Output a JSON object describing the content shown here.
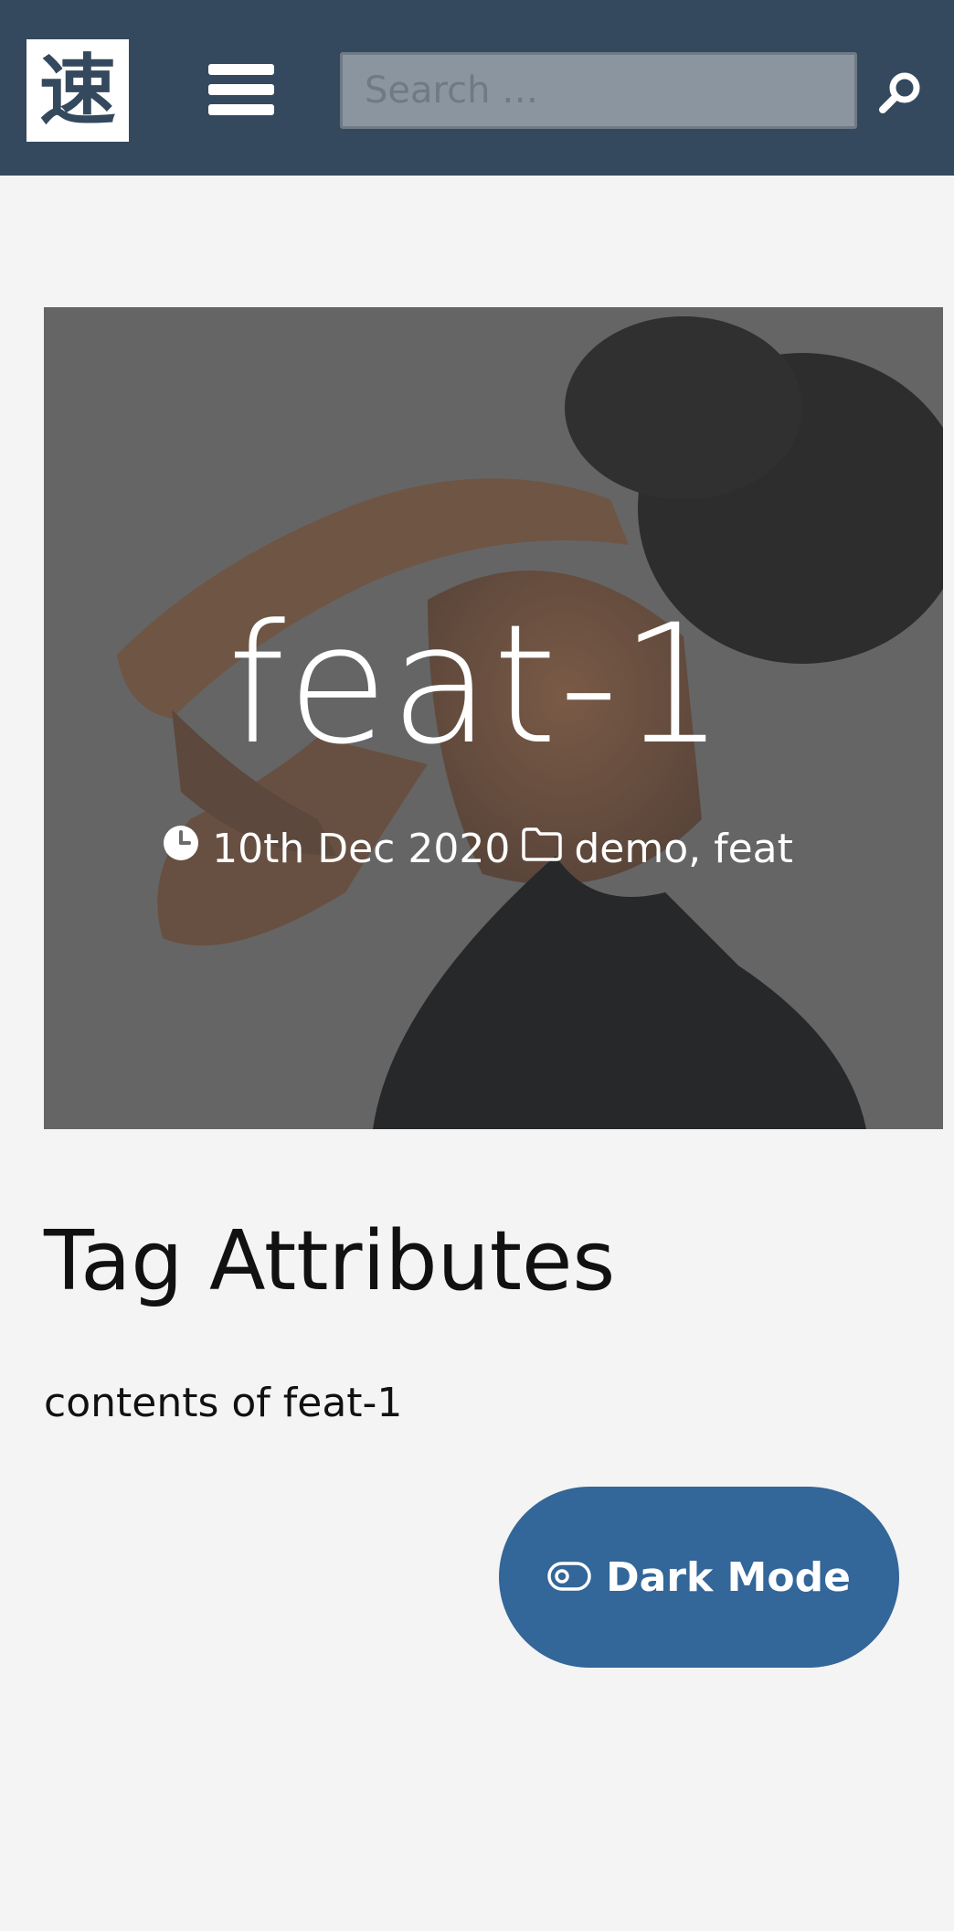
{
  "header": {
    "logo_text": "速",
    "menu_icon": "hamburger-menu-icon",
    "search": {
      "placeholder": "Search …",
      "value": "",
      "icon": "search-icon"
    }
  },
  "hero": {
    "title": "feat-1",
    "date_icon": "clock-icon",
    "date": "10th Dec 2020",
    "category_icon": "folder-icon",
    "tags": [
      "demo",
      "feat"
    ],
    "separator": ","
  },
  "post": {
    "heading": "Tag Attributes",
    "body": "contents of feat-1"
  },
  "dark_mode_button": {
    "icon": "toggle-icon",
    "label": "Dark Mode"
  },
  "colors": {
    "header_bg": "#34495e",
    "page_bg": "#f4f4f4",
    "button_bg": "#336699"
  }
}
